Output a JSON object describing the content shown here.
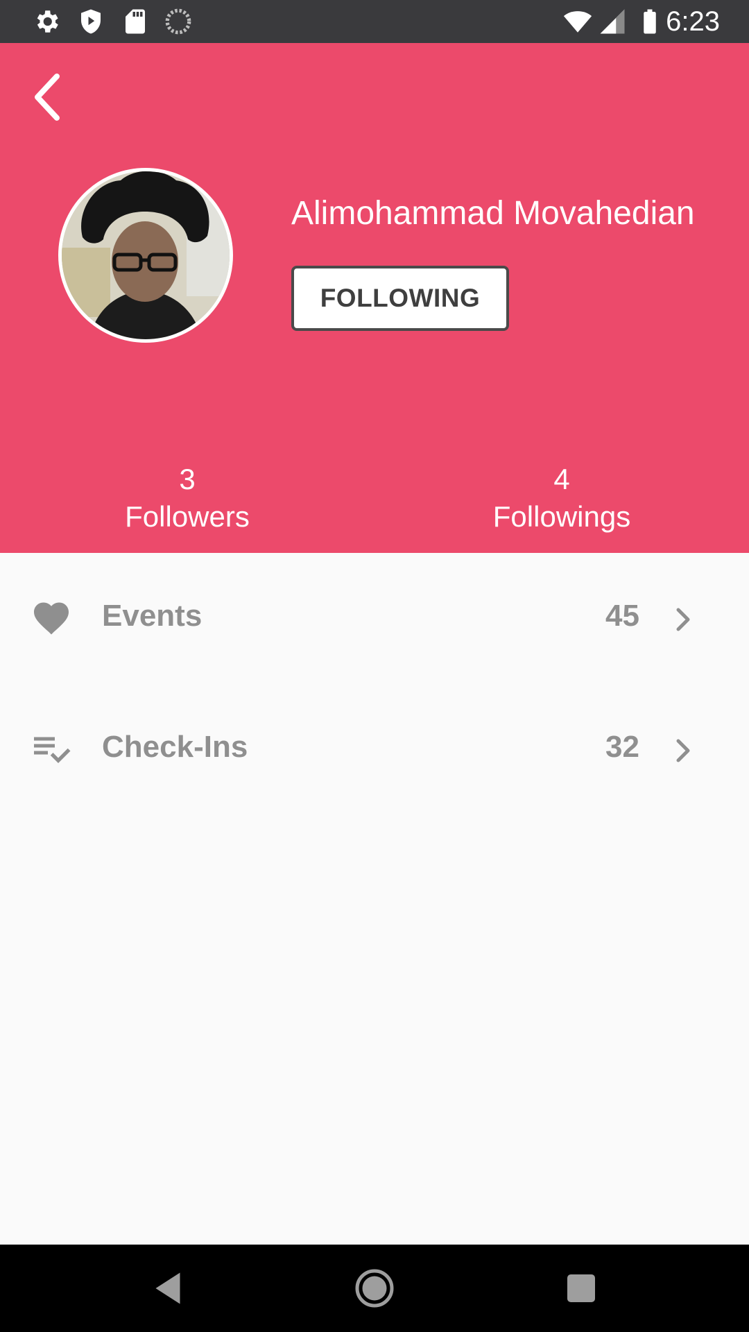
{
  "status_bar": {
    "time": "6:23",
    "left_icons": [
      "settings-icon",
      "shield-icon",
      "sd-card-icon",
      "sync-icon"
    ],
    "right_icons": [
      "wifi-icon",
      "cell-signal-icon",
      "battery-icon"
    ]
  },
  "header": {
    "background_color": "#ec4a6b",
    "back_icon": "chevron-left-icon",
    "profile_name": "Alimohammad Movahedian",
    "follow_button_label": "FOLLOWING",
    "followers": {
      "count": "3",
      "label": "Followers"
    },
    "followings": {
      "count": "4",
      "label": "Followings"
    }
  },
  "list": {
    "items": [
      {
        "icon": "heart-icon",
        "label": "Events",
        "count": "45"
      },
      {
        "icon": "playlist-check-icon",
        "label": "Check-Ins",
        "count": "32"
      }
    ]
  },
  "nav_bar": {
    "buttons": [
      "back-triangle-icon",
      "home-circle-icon",
      "recents-square-icon"
    ]
  }
}
